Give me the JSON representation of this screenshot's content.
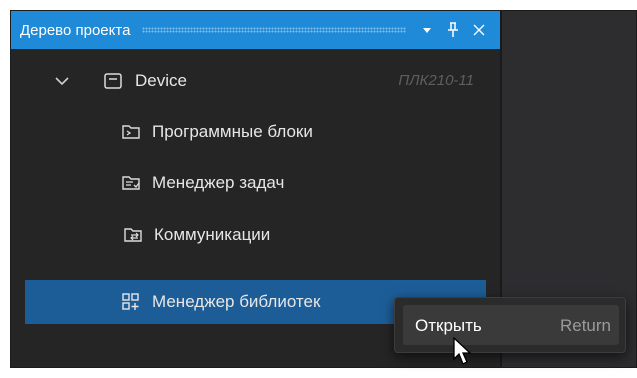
{
  "panel": {
    "title": "Дерево проекта",
    "buttons": {
      "dropdown_icon": "triangle-down-icon",
      "pin_icon": "pin-icon",
      "close_icon": "close-icon"
    }
  },
  "tree": {
    "root": {
      "label": "Device",
      "hint": "ПЛК210-11",
      "icon": "device-icon",
      "expanded": true
    },
    "children": [
      {
        "label": "Программные блоки",
        "icon": "program-blocks-icon"
      },
      {
        "label": "Менеджер задач",
        "icon": "task-manager-icon"
      },
      {
        "label": "Коммуникации",
        "icon": "communications-icon"
      },
      {
        "label": "Менеджер библиотек",
        "icon": "library-manager-icon",
        "selected": true
      }
    ]
  },
  "context_menu": {
    "items": [
      {
        "label": "Открыть",
        "shortcut": "Return"
      }
    ]
  },
  "colors": {
    "titlebar": "#1e8ad8",
    "selection": "#1d5d97",
    "panel_bg": "#252526",
    "text": "#e6e6e6",
    "hint": "#5e5e5e"
  }
}
